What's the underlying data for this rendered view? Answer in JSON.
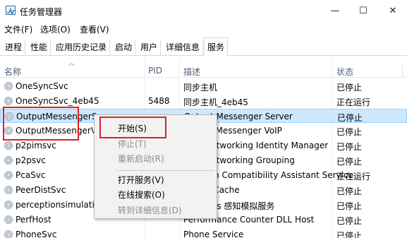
{
  "window": {
    "title": "任务管理器",
    "minimize": "—",
    "maximize": "☐",
    "close": "✕"
  },
  "menu": [
    "文件(F)",
    "选项(O)",
    "查看(V)"
  ],
  "tabs": [
    "进程",
    "性能",
    "应用历史记录",
    "启动",
    "用户",
    "详细信息",
    "服务"
  ],
  "active_tab": "服务",
  "columns": {
    "name": "名称",
    "pid": "PID",
    "desc": "描述",
    "status": "状态"
  },
  "sort_indicator": "︿",
  "rows": [
    {
      "name": "OneSyncSvc",
      "pid": "",
      "desc": "同步主机",
      "status": "已停止"
    },
    {
      "name": "OneSyncSvc_4eb45",
      "pid": "5488",
      "desc": "同步主机_4eb45",
      "status": "正在运行"
    },
    {
      "name": "OutputMessengerServer",
      "pid": "",
      "desc": "Output Messenger Server",
      "status": "已停止"
    },
    {
      "name": "OutputMessengerVoIP",
      "pid": "",
      "desc": "Output Messenger VoIP",
      "status": "已停止"
    },
    {
      "name": "p2pimsvc",
      "pid": "",
      "desc": "Peer Networking Identity Manager",
      "status": "已停止"
    },
    {
      "name": "p2psvc",
      "pid": "",
      "desc": "Peer Networking Grouping",
      "status": "已停止"
    },
    {
      "name": "PcaSvc",
      "pid": "",
      "desc": "Program Compatibility Assistant Service",
      "status": "正在运行"
    },
    {
      "name": "PeerDistSvc",
      "pid": "",
      "desc": "BranchCache",
      "status": "已停止"
    },
    {
      "name": "perceptionsimulation",
      "pid": "",
      "desc": "Windows 感知模拟服务",
      "status": "已停止"
    },
    {
      "name": "PerfHost",
      "pid": "",
      "desc": "Performance Counter DLL Host",
      "status": "已停止"
    },
    {
      "name": "PhoneSvc",
      "pid": "",
      "desc": "Phone Service",
      "status": "已停止"
    }
  ],
  "context_menu": [
    {
      "label": "开始(S)",
      "enabled": true
    },
    {
      "label": "停止(T)",
      "enabled": false
    },
    {
      "label": "重新启动(R)",
      "enabled": false
    },
    {
      "label": "打开服务(V)",
      "enabled": true
    },
    {
      "label": "在线搜索(O)",
      "enabled": true
    },
    {
      "label": "转到详细信息(D)",
      "enabled": false
    }
  ],
  "colors": {
    "selection": "#cce8ff",
    "highlight_box": "#e02020",
    "header_text": "#4c607a"
  }
}
